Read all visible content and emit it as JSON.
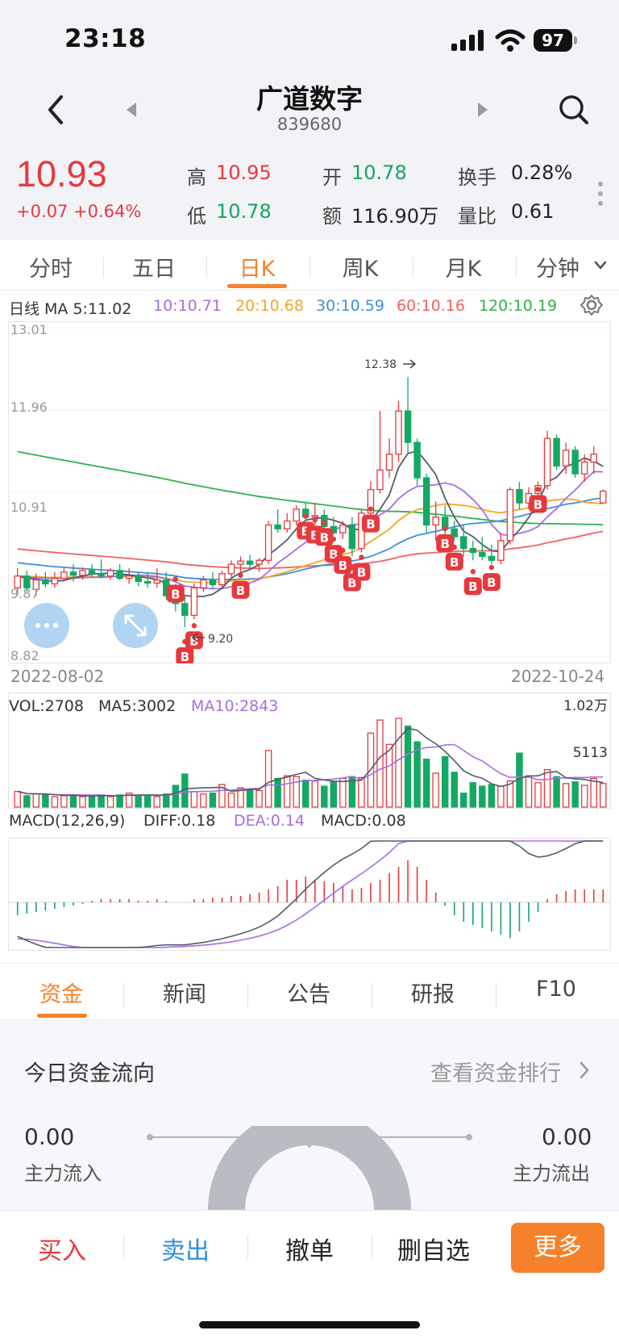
{
  "status_bar": {
    "time": "23:18",
    "battery": "97"
  },
  "header": {
    "title": "广道数字",
    "code": "839680"
  },
  "quote": {
    "price": "10.93",
    "change": "+0.07 +0.64%",
    "high_label": "高",
    "high": "10.95",
    "low_label": "低",
    "low": "10.78",
    "open_label": "开",
    "open": "10.78",
    "amount_label": "额",
    "amount": "116.90万",
    "turnover_label": "换手",
    "turnover": "0.28%",
    "vol_ratio_label": "量比",
    "vol_ratio": "0.61"
  },
  "chart_tabs": [
    "分时",
    "五日",
    "日K",
    "周K",
    "月K",
    "分钟"
  ],
  "active_chart_tab": "日K",
  "ma_legend": {
    "prefix": "日线 MA 5:11.02",
    "ma10": "10:10.71",
    "ma20": "20:10.68",
    "ma30": "30:10.59",
    "ma60": "60:10.16",
    "ma120": "120:10.19"
  },
  "colors": {
    "ma5": "#555b66",
    "ma10": "#a56ee5",
    "ma20": "#f5a623",
    "ma30": "#3d8fe0",
    "ma60": "#f06262",
    "ma120": "#2db34a",
    "up": "#e8383d",
    "down": "#14a865",
    "accent": "#f5822a"
  },
  "vol_legend": {
    "vol": "VOL:2708",
    "ma5": "MA5:3002",
    "ma10": "MA10:2843"
  },
  "macd_legend": {
    "title": "MACD(12,26,9)",
    "diff": "DIFF:0.18",
    "dea": "DEA:0.14",
    "macd": "MACD:0.08"
  },
  "chart_data": [
    {
      "type": "candlestick",
      "title": "日线",
      "y_ticks": [
        "13.01",
        "11.96",
        "10.91",
        "9.87",
        "8.82"
      ],
      "ylim": [
        8.82,
        13.01
      ],
      "x_start": "2022-08-02",
      "x_end": "2022-10-24",
      "annotations": [
        {
          "text": "12.38",
          "kind": "high"
        },
        {
          "text": "9.20",
          "kind": "low"
        }
      ],
      "signal_label": "B",
      "ohlc": [
        [
          9.7,
          9.95,
          9.6,
          9.85
        ],
        [
          9.85,
          9.92,
          9.65,
          9.7
        ],
        [
          9.68,
          9.88,
          9.6,
          9.8
        ],
        [
          9.8,
          9.9,
          9.7,
          9.75
        ],
        [
          9.75,
          9.9,
          9.7,
          9.82
        ],
        [
          9.82,
          9.95,
          9.78,
          9.9
        ],
        [
          9.9,
          10.0,
          9.78,
          9.86
        ],
        [
          9.86,
          9.96,
          9.8,
          9.92
        ],
        [
          9.92,
          10.0,
          9.84,
          9.88
        ],
        [
          9.88,
          10.06,
          9.82,
          9.85
        ],
        [
          9.85,
          9.95,
          9.8,
          9.92
        ],
        [
          9.92,
          10.0,
          9.8,
          9.82
        ],
        [
          9.82,
          9.95,
          9.75,
          9.85
        ],
        [
          9.85,
          9.9,
          9.72,
          9.78
        ],
        [
          9.78,
          9.88,
          9.7,
          9.76
        ],
        [
          9.76,
          9.95,
          9.7,
          9.8
        ],
        [
          9.8,
          9.9,
          9.55,
          9.6
        ],
        [
          9.6,
          9.75,
          9.4,
          9.5
        ],
        [
          9.5,
          9.6,
          9.2,
          9.35
        ],
        [
          9.35,
          9.75,
          9.3,
          9.7
        ],
        [
          9.7,
          9.85,
          9.65,
          9.8
        ],
        [
          9.8,
          9.9,
          9.68,
          9.74
        ],
        [
          9.74,
          9.92,
          9.7,
          9.88
        ],
        [
          9.88,
          10.05,
          9.84,
          10.0
        ],
        [
          10.0,
          10.1,
          9.9,
          10.04
        ],
        [
          10.04,
          10.12,
          9.95,
          10.0
        ],
        [
          10.0,
          10.08,
          9.9,
          10.05
        ],
        [
          10.05,
          10.55,
          10.0,
          10.5
        ],
        [
          10.5,
          10.7,
          10.4,
          10.45
        ],
        [
          10.45,
          10.65,
          10.4,
          10.55
        ],
        [
          10.55,
          10.75,
          10.5,
          10.7
        ],
        [
          10.7,
          10.78,
          10.55,
          10.6
        ],
        [
          10.6,
          10.78,
          10.5,
          10.62
        ],
        [
          10.62,
          10.7,
          10.45,
          10.48
        ],
        [
          10.48,
          10.6,
          10.38,
          10.4
        ],
        [
          10.4,
          10.55,
          10.32,
          10.5
        ],
        [
          10.5,
          10.6,
          10.1,
          10.2
        ],
        [
          10.2,
          10.7,
          10.15,
          10.65
        ],
        [
          10.65,
          11.05,
          10.6,
          10.95
        ],
        [
          10.95,
          11.95,
          10.9,
          11.2
        ],
        [
          11.2,
          11.6,
          11.1,
          11.4
        ],
        [
          11.4,
          12.08,
          11.3,
          11.95
        ],
        [
          11.95,
          12.38,
          11.4,
          11.55
        ],
        [
          11.55,
          11.6,
          11.0,
          11.1
        ],
        [
          11.1,
          11.15,
          10.4,
          10.5
        ],
        [
          10.5,
          10.8,
          10.3,
          10.6
        ],
        [
          10.6,
          10.75,
          10.35,
          10.45
        ],
        [
          10.45,
          10.55,
          10.3,
          10.35
        ],
        [
          10.35,
          10.5,
          10.1,
          10.2
        ],
        [
          10.2,
          10.3,
          10.05,
          10.15
        ],
        [
          10.15,
          10.35,
          10.05,
          10.1
        ],
        [
          10.1,
          10.25,
          10.0,
          10.05
        ],
        [
          10.05,
          10.4,
          10.0,
          10.3
        ],
        [
          10.3,
          10.98,
          10.25,
          10.95
        ],
        [
          10.95,
          11.05,
          10.7,
          10.78
        ],
        [
          10.78,
          10.98,
          10.7,
          10.9
        ],
        [
          10.9,
          11.05,
          10.85,
          11.0
        ],
        [
          11.0,
          11.7,
          10.95,
          11.6
        ],
        [
          11.6,
          11.65,
          11.2,
          11.25
        ],
        [
          11.25,
          11.55,
          11.15,
          11.45
        ],
        [
          11.45,
          11.5,
          11.1,
          11.15
        ],
        [
          11.15,
          11.4,
          11.05,
          11.3
        ],
        [
          11.3,
          11.5,
          11.15,
          11.4
        ],
        [
          10.78,
          10.95,
          10.78,
          10.93
        ]
      ]
    },
    {
      "type": "bar",
      "title": "VOL",
      "y_ticks": [
        "1.02万",
        "5113"
      ],
      "values": [
        1800,
        1300,
        1500,
        1400,
        1200,
        1300,
        1400,
        1200,
        1300,
        1400,
        1200,
        1400,
        1600,
        1300,
        1400,
        1200,
        1500,
        2500,
        3800,
        1800,
        1500,
        1600,
        2600,
        1600,
        2200,
        2000,
        1900,
        6500,
        3300,
        3600,
        3500,
        3100,
        3000,
        2400,
        2900,
        3300,
        3500,
        3400,
        8500,
        10000,
        7200,
        10200,
        9300,
        7500,
        5500,
        3900,
        5800,
        4000,
        1600,
        2800,
        2400,
        2600,
        2400,
        3000,
        6200,
        3600,
        2800,
        4300,
        3500,
        2700,
        2900,
        2500,
        3300,
        2708
      ]
    },
    {
      "type": "bar",
      "title": "MACD(12,26,9)",
      "values": [
        -0.08,
        -0.07,
        -0.06,
        -0.05,
        -0.04,
        -0.03,
        -0.02,
        -0.01,
        0.01,
        0.02,
        0.02,
        0.02,
        0.02,
        0.01,
        0.01,
        0.02,
        0.01,
        0.0,
        0.0,
        0.02,
        0.02,
        0.03,
        0.03,
        0.04,
        0.04,
        0.05,
        0.06,
        0.08,
        0.1,
        0.14,
        0.14,
        0.16,
        0.14,
        0.13,
        0.12,
        0.1,
        0.08,
        0.09,
        0.12,
        0.14,
        0.18,
        0.22,
        0.26,
        0.22,
        0.14,
        0.06,
        -0.02,
        -0.08,
        -0.12,
        -0.14,
        -0.16,
        -0.18,
        -0.2,
        -0.22,
        -0.18,
        -0.12,
        -0.06,
        0.02,
        0.05,
        0.07,
        0.08,
        0.08,
        0.08,
        0.08
      ]
    }
  ],
  "bottom_tabs": [
    "资金",
    "新闻",
    "公告",
    "研报",
    "F10"
  ],
  "active_bottom_tab": "资金",
  "fund_flow": {
    "title": "今日资金流向",
    "link": "查看资金排行",
    "inflow_value": "0.00",
    "inflow_label": "主力流入",
    "outflow_value": "0.00",
    "outflow_label": "主力流出"
  },
  "actions": {
    "buy": "买入",
    "sell": "卖出",
    "cancel": "撤单",
    "remove_watch": "删自选",
    "more": "更多"
  }
}
